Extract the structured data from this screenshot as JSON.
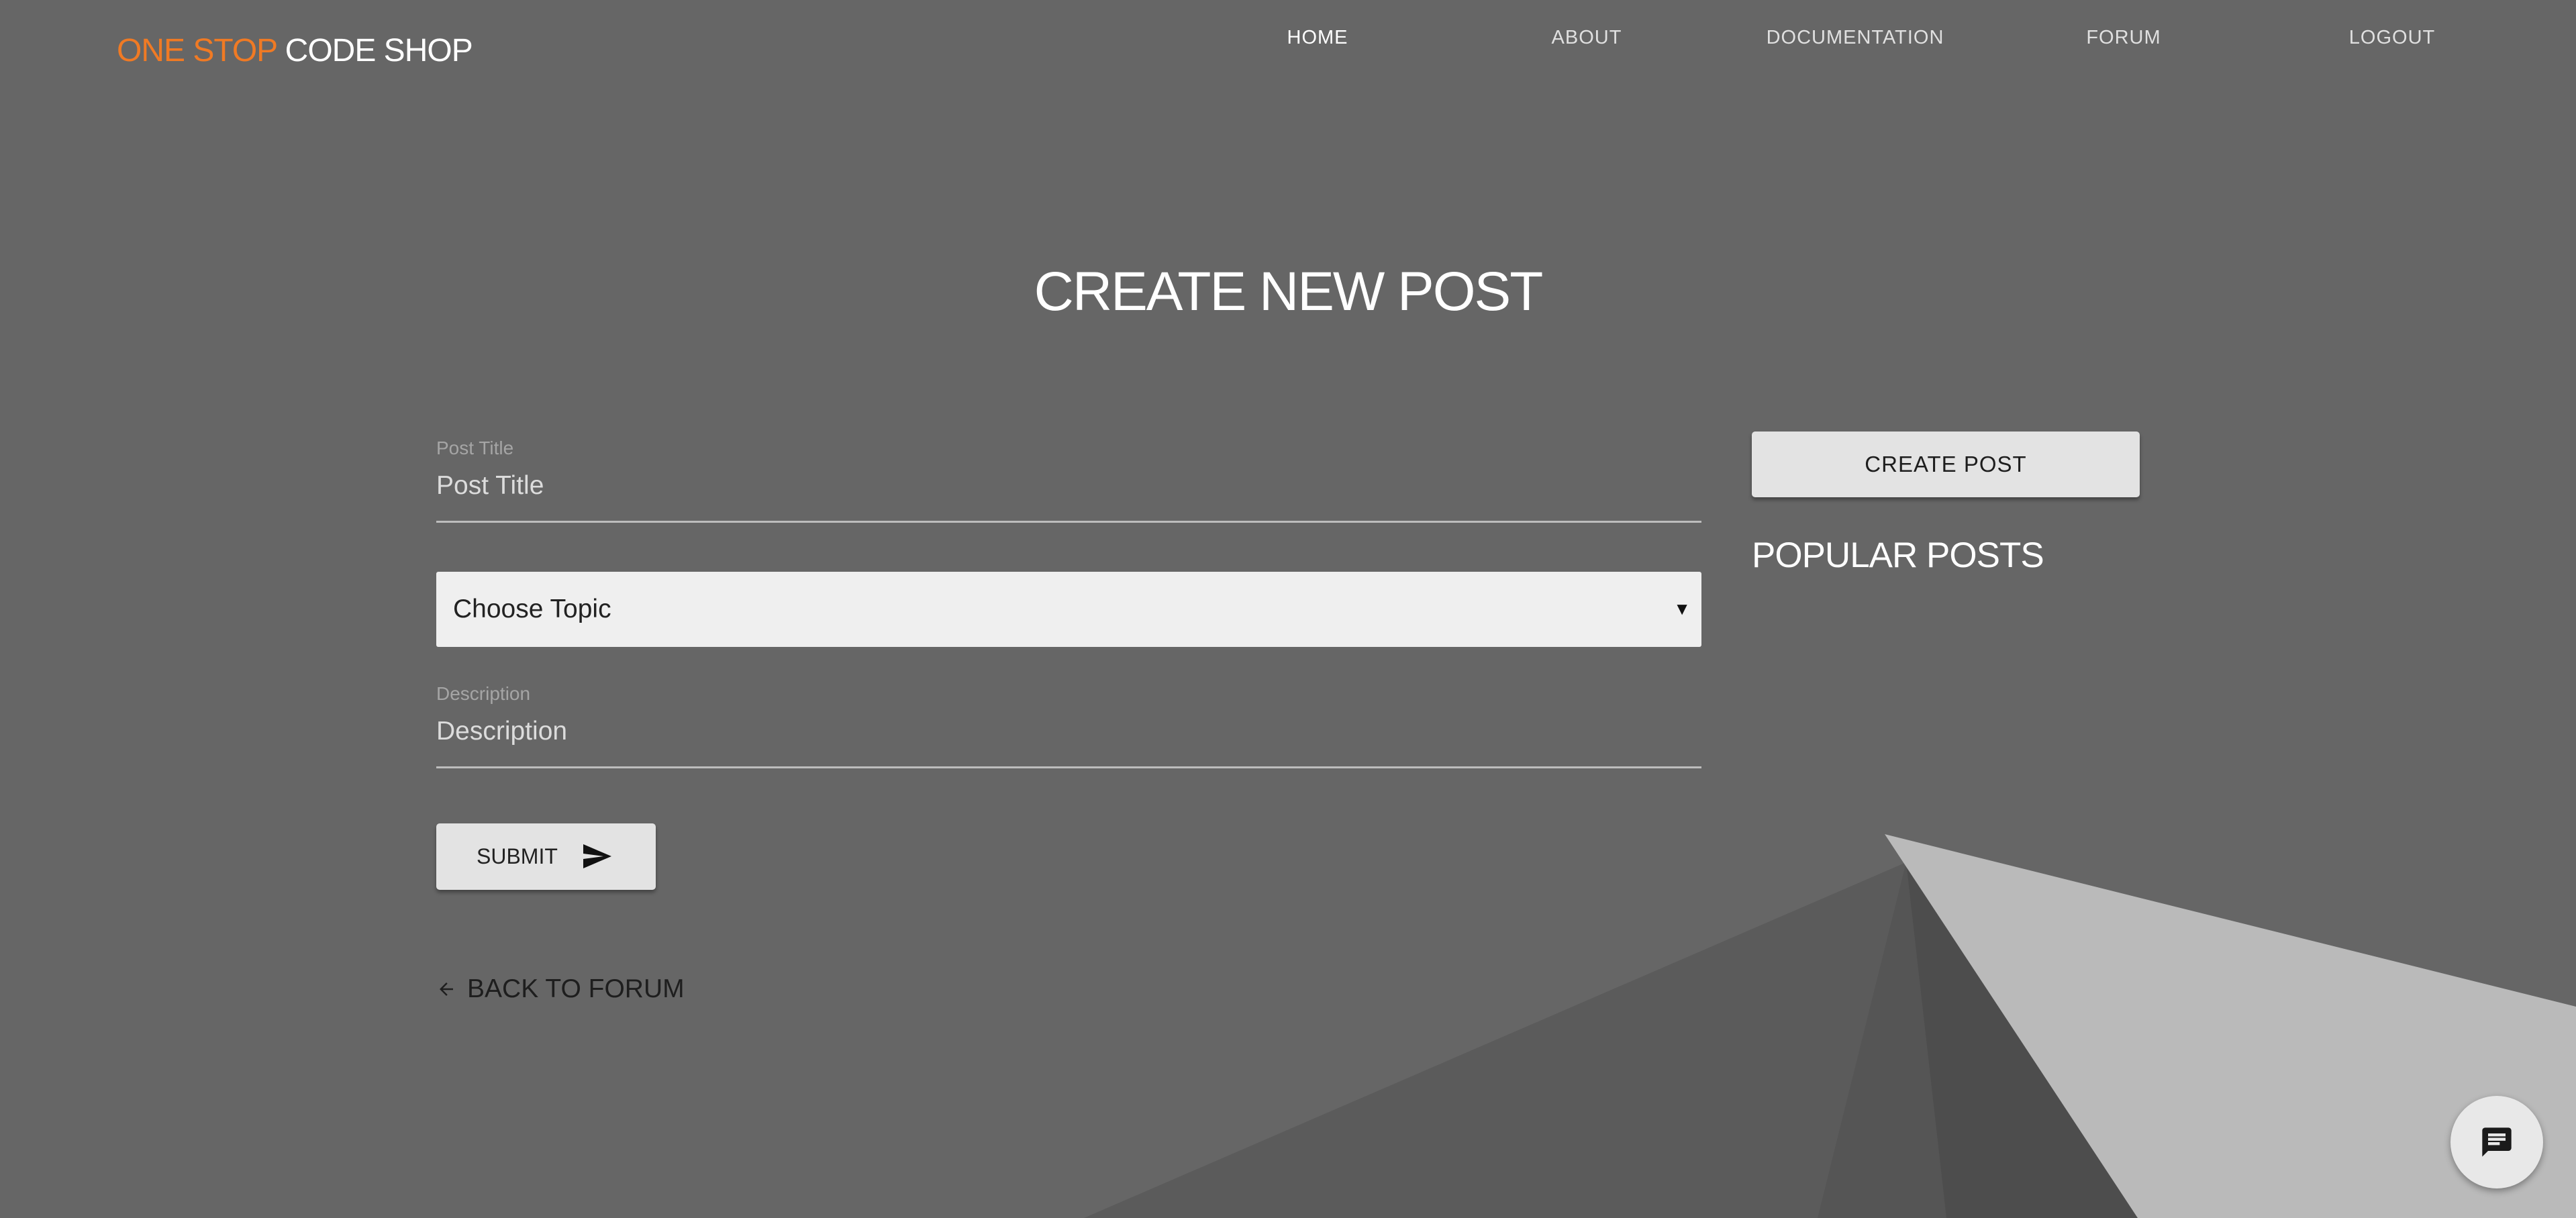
{
  "brand": {
    "accent": "ONE STOP",
    "rest": "CODE SHOP",
    "accent_color": "#f07a24"
  },
  "nav": {
    "items": [
      {
        "label": "HOME",
        "active": true
      },
      {
        "label": "ABOUT",
        "active": false
      },
      {
        "label": "DOCUMENTATION",
        "active": false
      },
      {
        "label": "FORUM",
        "active": false
      },
      {
        "label": "LOGOUT",
        "active": false
      }
    ]
  },
  "page": {
    "title": "CREATE NEW POST"
  },
  "form": {
    "title_label": "Post Title",
    "title_placeholder": "Post Title",
    "topic_value": "Choose Topic",
    "description_label": "Description",
    "description_placeholder": "Description",
    "submit_label": "SUBMIT",
    "back_label": "BACK TO FORUM"
  },
  "sidebar": {
    "create_label": "CREATE POST",
    "popular_heading": "POPULAR POSTS"
  },
  "icons": {
    "submit": "send-icon",
    "back": "arrow-left-icon",
    "chat": "chat-icon",
    "select": "caret-down-icon"
  },
  "colors": {
    "background": "#666666",
    "button_bg": "#e3e3e3",
    "select_bg": "#efefef"
  }
}
